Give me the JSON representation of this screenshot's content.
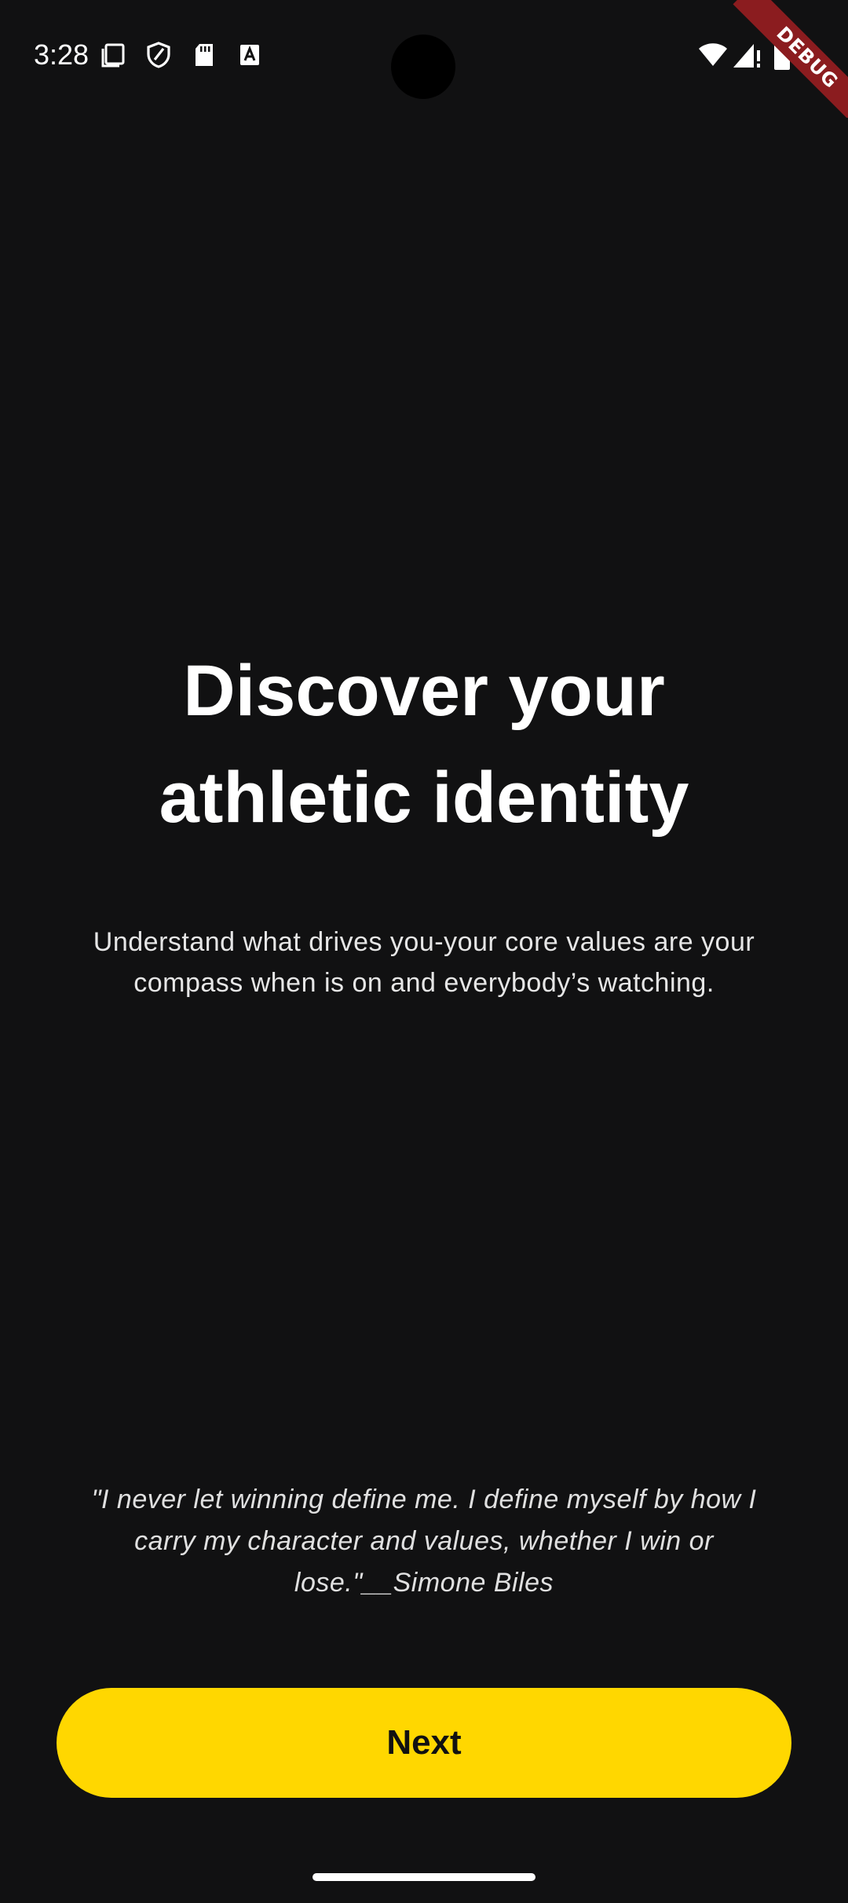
{
  "status_bar": {
    "time": "3:28",
    "left_icons": [
      "notification-screenshot-icon",
      "shield-icon",
      "sd-card-icon",
      "a-letter-icon"
    ],
    "right_icons": [
      "wifi-icon",
      "cell-signal-icon",
      "battery-icon"
    ]
  },
  "debug_banner": {
    "label": "DEBUG",
    "color": "#8b1c1f"
  },
  "onboarding": {
    "headline_line1": "Discover your",
    "headline_line2": "athletic identity",
    "subtitle_line1": "Understand what drives you-your core values are your",
    "subtitle_line2": "compass when is on and everybody’s watching.",
    "quote_line1": "\"I never let winning define me. I define myself by how I",
    "quote_line2": "carry my character and values, whether I win or",
    "quote_line3": "lose.\"__Simone Biles",
    "next_label": "Next"
  },
  "colors": {
    "background": "#111112",
    "accent": "#ffd700",
    "text": "#ffffff"
  }
}
